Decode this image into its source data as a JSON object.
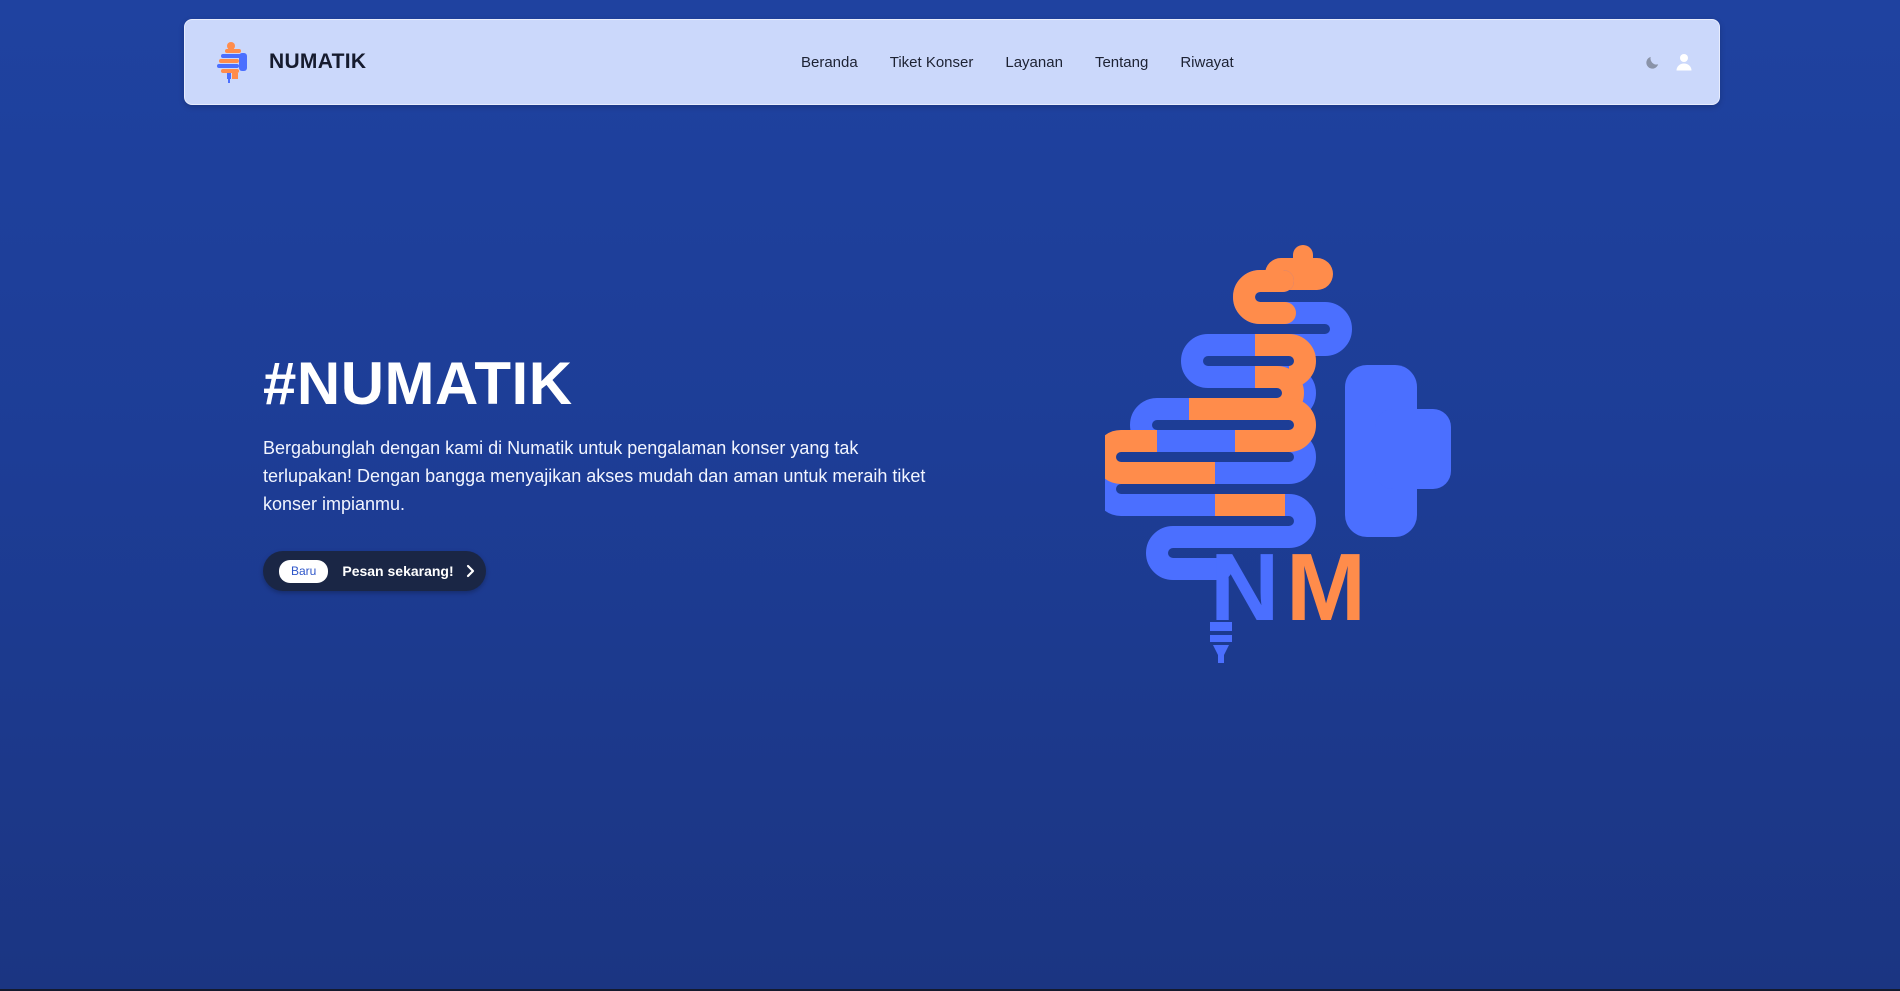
{
  "navbar": {
    "brand_name": "NUMATIK",
    "logo_icon": "numatik-logo-icon",
    "links": [
      {
        "label": "Beranda"
      },
      {
        "label": "Tiket Konser"
      },
      {
        "label": "Layanan"
      },
      {
        "label": "Tentang"
      },
      {
        "label": "Riwayat"
      }
    ],
    "icons": [
      "moon-icon",
      "user-icon"
    ]
  },
  "hero": {
    "title": "#NUMATIK",
    "description": "Bergabunglah dengan kami di Numatik untuk pengalaman konser yang tak terlupakan! Dengan bangga menyajikan akses mudah dan aman untuk meraih tiket konser impianmu.",
    "cta": {
      "badge": "Baru",
      "label": "Pesan sekarang!",
      "icon": "chevron-right-icon"
    },
    "illustration_letters": "NM"
  },
  "colors": {
    "background": "#1f42a0",
    "navbar_bg": "#cbd8fb",
    "accent_orange": "#ff8c4b",
    "accent_blue": "#4b6fff",
    "cta_bg": "#1a2645"
  }
}
